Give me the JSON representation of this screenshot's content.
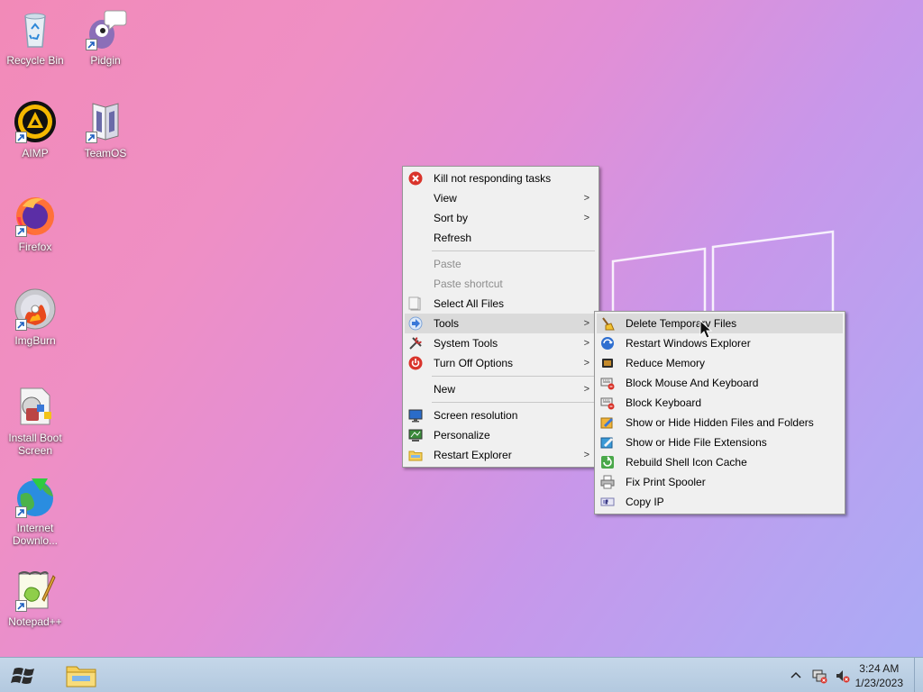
{
  "desktop_icons": [
    {
      "label": "Recycle Bin",
      "icon": "recycle-bin-icon"
    },
    {
      "label": "Pidgin",
      "icon": "pidgin-icon"
    },
    {
      "label": "AIMP",
      "icon": "aimp-icon"
    },
    {
      "label": "TeamOS",
      "icon": "teamos-icon"
    },
    {
      "label": "Firefox",
      "icon": "firefox-icon"
    },
    {
      "label": "ImgBurn",
      "icon": "imgburn-icon"
    },
    {
      "label": "Install Boot Screen",
      "icon": "install-boot-screen-icon"
    },
    {
      "label": "Internet Downlo...",
      "icon": "internet-download-manager-icon"
    },
    {
      "label": "Notepad++",
      "icon": "notepadpp-icon"
    }
  ],
  "context_menu": {
    "items": [
      {
        "label": "Kill not responding tasks",
        "icon": "kill-tasks-icon"
      },
      {
        "label": "View",
        "submenu": true
      },
      {
        "label": "Sort by",
        "submenu": true
      },
      {
        "label": "Refresh"
      },
      {
        "label": "Paste",
        "disabled": true
      },
      {
        "label": "Paste shortcut",
        "disabled": true
      },
      {
        "label": "Select All Files",
        "icon": "select-all-icon"
      },
      {
        "label": "Tools",
        "icon": "tools-arrow-icon",
        "submenu": true,
        "active": true
      },
      {
        "label": "System Tools",
        "icon": "system-tools-icon",
        "submenu": true
      },
      {
        "label": "Turn Off Options",
        "icon": "power-icon",
        "submenu": true
      },
      {
        "label": "New",
        "submenu": true
      },
      {
        "label": "Screen resolution",
        "icon": "monitor-icon"
      },
      {
        "label": "Personalize",
        "icon": "personalize-icon"
      },
      {
        "label": "Restart Explorer",
        "icon": "folder-icon",
        "submenu": true
      }
    ]
  },
  "tools_submenu": {
    "items": [
      {
        "label": "Delete Temporary Files",
        "icon": "broom-icon",
        "hover": true
      },
      {
        "label": "Restart Windows Explorer",
        "icon": "globe-restart-icon"
      },
      {
        "label": "Reduce Memory",
        "icon": "memory-chip-icon"
      },
      {
        "label": "Block Mouse And Keyboard",
        "icon": "keyboard-block-icon"
      },
      {
        "label": "Block Keyboard",
        "icon": "keyboard-icon"
      },
      {
        "label": "Show or Hide Hidden Files and Folders",
        "icon": "hidden-files-icon"
      },
      {
        "label": "Show or Hide File Extensions",
        "icon": "file-extensions-icon"
      },
      {
        "label": "Rebuild Shell Icon Cache",
        "icon": "rebuild-cache-icon"
      },
      {
        "label": "Fix Print Spooler",
        "icon": "printer-icon"
      },
      {
        "label": "Copy IP",
        "icon": "ip-icon"
      }
    ]
  },
  "taskbar": {
    "clock_time": "3:24 AM",
    "clock_date": "1/23/2023"
  },
  "submenu_arrow": ">"
}
